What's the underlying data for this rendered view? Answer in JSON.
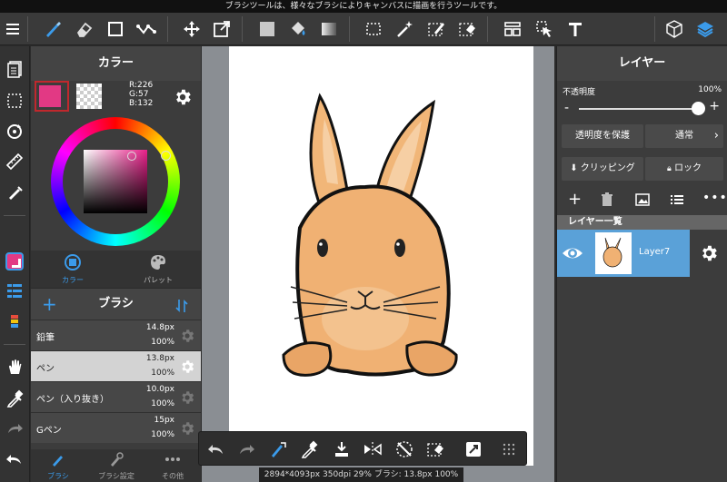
{
  "tooltip": "ブラシツールは、様々なブラシによりキャンバスに描画を行うツールです。",
  "toolbar": {
    "icons": [
      "menu-icon",
      "brush-icon",
      "eraser-icon",
      "rectangle-icon",
      "select-path-icon",
      "move-icon",
      "transform-icon",
      "fill-color-icon",
      "bucket-icon",
      "gradient-icon",
      "marquee-icon",
      "magic-wand-icon",
      "select-pen-icon",
      "select-eraser-icon",
      "layout-icon",
      "pointer-icon",
      "text-icon",
      "3d-cube-icon",
      "layers-icon"
    ],
    "accent": "#3b9bea"
  },
  "color_panel": {
    "title": "カラー",
    "main_color": "#e23984",
    "r": "R:226",
    "g": "G:57",
    "b": "B:132",
    "tab_color": "カラー",
    "tab_palette": "パレット"
  },
  "brush_panel": {
    "title": "ブラシ",
    "brushes": [
      {
        "name": "鉛筆",
        "size": "14.8px",
        "opacity": "100%"
      },
      {
        "name": "ペン",
        "size": "13.8px",
        "opacity": "100%"
      },
      {
        "name": "ペン（入り抜き）",
        "size": "10.0px",
        "opacity": "100%"
      },
      {
        "name": "Gペン",
        "size": "15px",
        "opacity": "100%"
      }
    ],
    "footer": {
      "brush": "ブラシ",
      "settings": "ブラシ設定",
      "other": "その他"
    }
  },
  "layer_panel": {
    "title": "レイヤー",
    "opacity_label": "不透明度",
    "opacity_value": "100%",
    "opacity": 1.0,
    "protect": "透明度を保護",
    "blend": "通常",
    "clipping": "クリッピング",
    "lock": "ロック",
    "list_title": "レイヤー一覧",
    "layer_name": "Layer7"
  },
  "status": "2894*4093px 350dpi 29% ブラシ: 13.8px 100%"
}
